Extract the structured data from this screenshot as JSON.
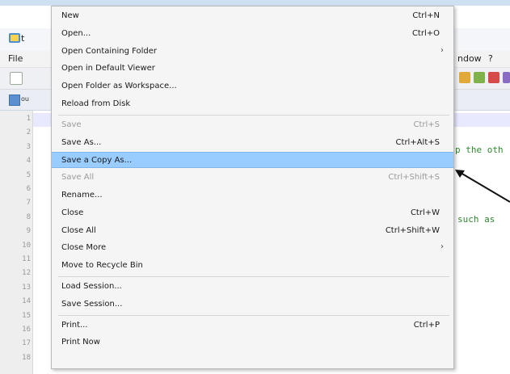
{
  "window": {
    "app_title_fragment": "t"
  },
  "menubar": {
    "file": "File",
    "window_fragment": "ndow",
    "help": "?"
  },
  "tab": {
    "label_fragment": "ou"
  },
  "line_numbers": [
    "1",
    "2",
    "3",
    "4",
    "5",
    "6",
    "7",
    "8",
    "9",
    "10",
    "11",
    "12",
    "13",
    "14",
    "15",
    "16",
    "17",
    "18"
  ],
  "code_fragments": {
    "line3": "p the oth",
    "line8": "such as"
  },
  "file_menu": {
    "items": [
      {
        "label": "New",
        "shortcut": "Ctrl+N"
      },
      {
        "label": "Open...",
        "shortcut": "Ctrl+O"
      },
      {
        "label": "Open Containing Folder",
        "submenu": "›"
      },
      {
        "label": "Open in Default Viewer"
      },
      {
        "label": "Open Folder as Workspace..."
      },
      {
        "label": "Reload from Disk"
      },
      {
        "label": "Save",
        "shortcut": "Ctrl+S",
        "disabled": true
      },
      {
        "label": "Save As...",
        "shortcut": "Ctrl+Alt+S"
      },
      {
        "label": "Save a Copy As...",
        "highlighted": true
      },
      {
        "label": "Save All",
        "shortcut": "Ctrl+Shift+S",
        "disabled": true
      },
      {
        "label": "Rename..."
      },
      {
        "label": "Close",
        "shortcut": "Ctrl+W"
      },
      {
        "label": "Close All",
        "shortcut": "Ctrl+Shift+W"
      },
      {
        "label": "Close More",
        "submenu": "›"
      },
      {
        "label": "Move to Recycle Bin"
      },
      {
        "label": "Load Session..."
      },
      {
        "label": "Save Session..."
      },
      {
        "label": "Print...",
        "shortcut": "Ctrl+P"
      },
      {
        "label": "Print Now"
      }
    ]
  },
  "colors": {
    "highlight": "#99ccff",
    "menu_bg": "#f5f5f5",
    "disabled_text": "#9a9a9a",
    "comment_green": "#2e8b2e"
  }
}
